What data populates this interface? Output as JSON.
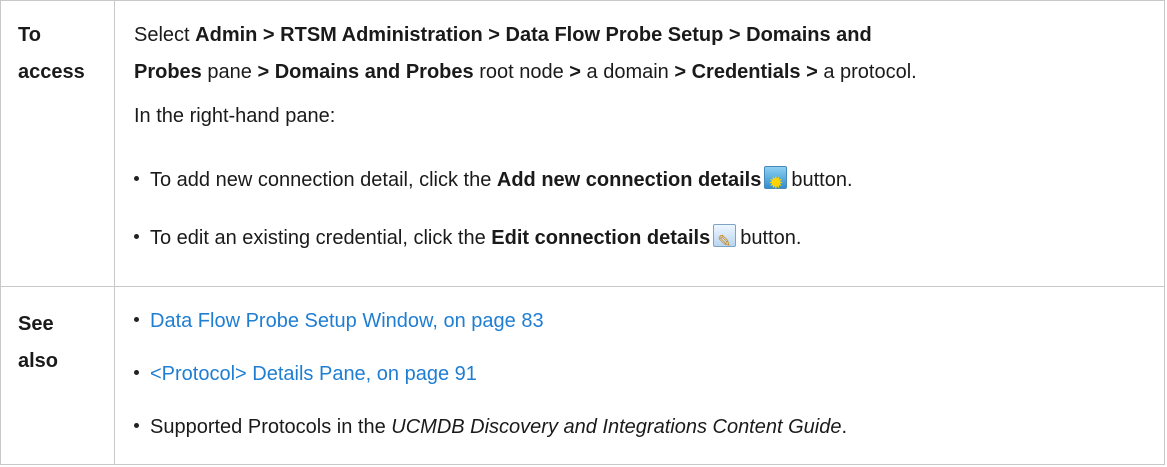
{
  "row1": {
    "header_line1": "To",
    "header_line2": "access",
    "select": "Select",
    "path_admin": "Admin > RTSM Administration > Data Flow Probe Setup > Domains and",
    "path_probes": "Probes",
    "pane": "pane",
    "gt1": ">",
    "domains_probes": "Domains and Probes",
    "root_node": "root node",
    "gt2": ">",
    "a_domain": "a domain",
    "gt3": ">",
    "credentials": "Credentials >",
    "a_protocol": "a protocol.",
    "right_pane": "In the right-hand pane:",
    "bullet_add_pre": "To add new connection detail, click the",
    "bullet_add_bold": "Add new connection details",
    "bullet_add_post": "button.",
    "bullet_edit_pre": "To edit an existing credential, click the",
    "bullet_edit_bold": "Edit connection details",
    "bullet_edit_post": "button."
  },
  "row2": {
    "header_line1": "See",
    "header_line2": "also",
    "link1": "Data Flow Probe Setup Window, on page 83",
    "link2": "<Protocol> Details Pane, on page 91",
    "item3_pre": "Supported Protocols in the",
    "item3_italic": "UCMDB Discovery and Integrations Content Guide",
    "item3_post": "."
  },
  "icons": {
    "add": "add-connection-star-icon",
    "edit": "edit-pencil-icon"
  },
  "colors": {
    "link": "#1f7ed2",
    "border": "#c8c8c8"
  }
}
